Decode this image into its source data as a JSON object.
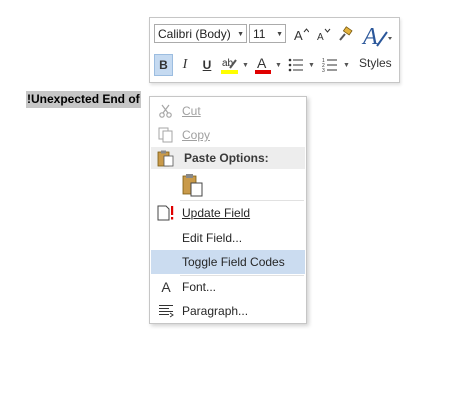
{
  "document": {
    "field_text": "!Unexpected End of"
  },
  "mini_toolbar": {
    "font_name": "Calibri (Body)",
    "font_size": "11",
    "bold": "B",
    "italic": "I",
    "underline": "U",
    "styles_label": "Styles"
  },
  "context_menu": {
    "cut": "Cut",
    "copy": "Copy",
    "paste_options": "Paste Options:",
    "update_field": "Update Field",
    "edit_field": "Edit Field...",
    "toggle_field_codes": "Toggle Field Codes",
    "font": "Font...",
    "paragraph": "Paragraph..."
  },
  "colors": {
    "highlight_yellow": "#ffff00",
    "font_red": "#e00000",
    "menu_hover": "#cbdcf0",
    "accent_blue": "#2b579a"
  }
}
